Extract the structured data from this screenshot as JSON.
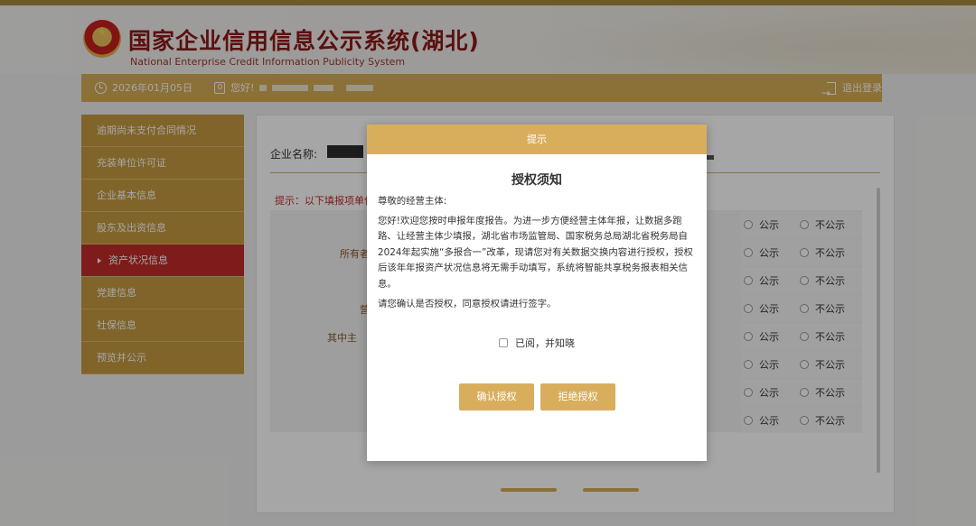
{
  "header": {
    "site_title": "国家企业信用信息公示系统(湖北)",
    "site_subtitle": "National Enterprise Credit Information Publicity System",
    "emblem_icon": "national-emblem"
  },
  "user_bar": {
    "date": "2026年01月05日",
    "greeting": "您好!",
    "logout_label": "退出登录",
    "icons": [
      "clock-icon",
      "user-icon",
      "logout-icon"
    ]
  },
  "sidebar": {
    "items": [
      {
        "label": "逾期尚未支付合同情况"
      },
      {
        "label": "充装单位许可证"
      },
      {
        "label": "企业基本信息"
      },
      {
        "label": "股东及出资信息"
      },
      {
        "label": "资产状况信息",
        "active": true
      },
      {
        "label": "党建信息"
      },
      {
        "label": "社保信息"
      },
      {
        "label": "预览并公示"
      }
    ]
  },
  "main": {
    "company_label": "企业名称:",
    "hint": "提示：以下填报项单位",
    "row_labels": [
      "所有者",
      "营",
      "其中主"
    ],
    "radio_options": {
      "public": "公示",
      "private": "不公示"
    },
    "radio_row_count": 8
  },
  "modal": {
    "header": "提示",
    "title": "授权须知",
    "salutation": "尊敬的经营主体:",
    "paragraph1": "您好!欢迎您按时申报年度报告。为进一步方便经营主体年报，让数据多跑路、让经营主体少填报，湖北省市场监管局、国家税务总局湖北省税务局自2024年起实施“多报合一”改革，现请您对有关数据交换内容进行授权，授权后该年年报资产状况信息将无需手动填写，系统将智能共享税务报表相关信息。",
    "paragraph2": "请您确认是否授权，同意授权请进行签字。",
    "checkbox_label": "已阅，并知晓",
    "confirm_button": "确认授权",
    "reject_button": "拒绝授权"
  },
  "colors": {
    "gold": "#d6ac55",
    "sidebar_gold": "#c59a3f",
    "active_red": "#c22b2b",
    "title_red": "#8b1a17"
  }
}
